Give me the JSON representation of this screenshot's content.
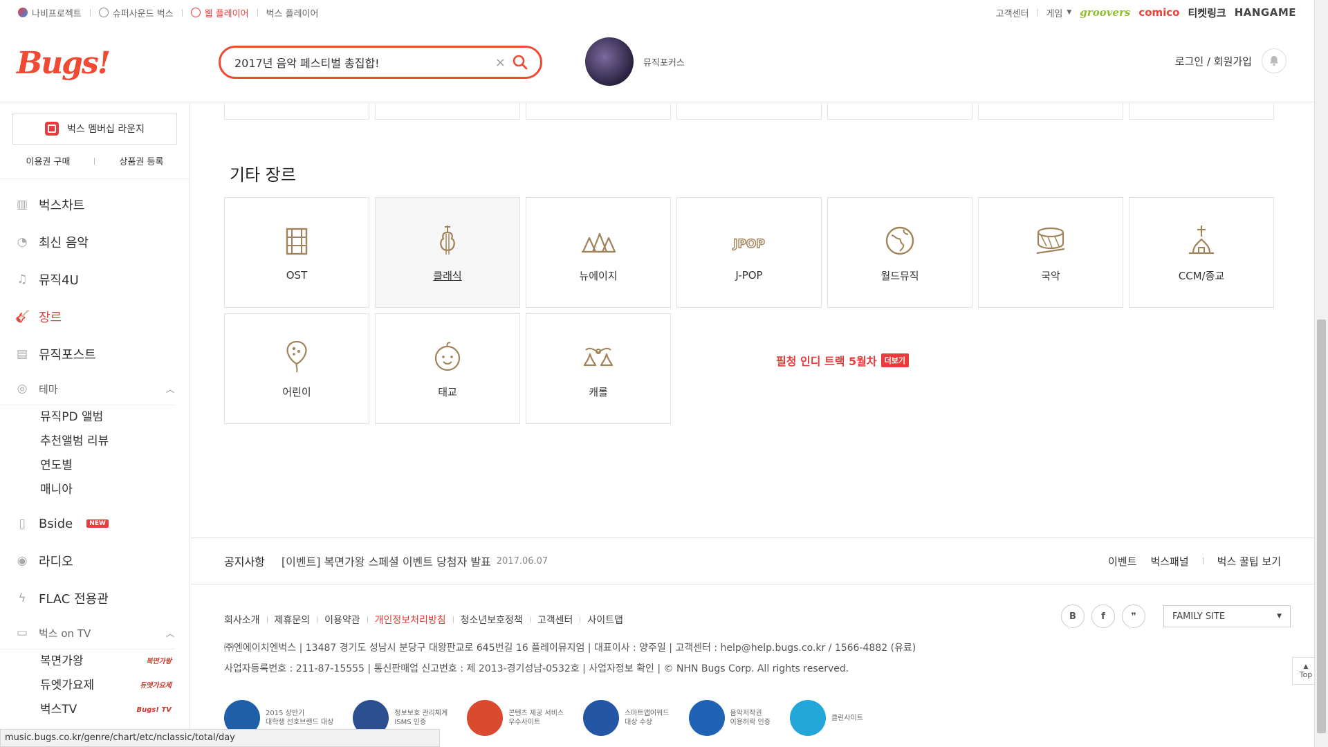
{
  "topbar": {
    "left_items": [
      {
        "label": "나비프로젝트",
        "active": false,
        "icon": "butterfly-icon"
      },
      {
        "label": "슈퍼사운드 벅스",
        "active": false,
        "icon": "bolt-icon"
      },
      {
        "label": "웹 플레이어",
        "active": true,
        "icon": "play-icon"
      },
      {
        "label": "벅스 플레이어",
        "active": false,
        "icon": ""
      }
    ],
    "right_links": [
      "고객센터",
      "게임"
    ],
    "brands": [
      "groovers",
      "comico",
      "티켓링크",
      "HANGAME"
    ]
  },
  "header": {
    "logo": "Bugs!",
    "search_value": "2017년 음악 페스티벌 총집합!",
    "promo_sub": "뮤직포커스",
    "promo_main": "필청 인디 트랙 5월차",
    "promo_more": "더보기",
    "login": "로그인 / 회원가입"
  },
  "sidebar": {
    "member_lounge": "벅스 멤버십 라운지",
    "buy": "이용권 구매",
    "coupon": "상품권 등록",
    "nav": [
      {
        "label": "벅스차트",
        "icon": "chart-icon",
        "active": false
      },
      {
        "label": "최신 음악",
        "icon": "new-music-icon",
        "active": false
      },
      {
        "label": "뮤직4U",
        "icon": "note-icon",
        "active": false
      },
      {
        "label": "장르",
        "icon": "guitar-icon",
        "active": true
      },
      {
        "label": "뮤직포스트",
        "icon": "post-icon",
        "active": false
      }
    ],
    "theme_label": "테마",
    "theme_items": [
      "뮤직PD 앨범",
      "추천앨범 리뷰",
      "연도별",
      "매니아"
    ],
    "nav2": [
      {
        "label": "Bside",
        "icon": "bside-icon",
        "new": "NEW"
      },
      {
        "label": "라디오",
        "icon": "radio-icon",
        "new": ""
      },
      {
        "label": "FLAC 전용관",
        "icon": "flac-icon",
        "new": ""
      }
    ],
    "tv_label": "벅스 on TV",
    "tv_items": [
      {
        "label": "복면가왕",
        "badge": "복면가왕"
      },
      {
        "label": "듀엣가요제",
        "badge": "듀엣가요제"
      },
      {
        "label": "벅스TV",
        "badge": "Bugs! TV"
      }
    ]
  },
  "main": {
    "section_title": "기타 장르",
    "genres": [
      {
        "label": "OST",
        "icon": "film-icon",
        "hover": false
      },
      {
        "label": "클래식",
        "icon": "violin-icon",
        "hover": true
      },
      {
        "label": "뉴에이지",
        "icon": "trees-icon",
        "hover": false
      },
      {
        "label": "J-POP",
        "icon": "jpop-icon",
        "hover": false
      },
      {
        "label": "월드뮤직",
        "icon": "globe-icon",
        "hover": false
      },
      {
        "label": "국악",
        "icon": "drum-icon",
        "hover": false
      },
      {
        "label": "CCM/종교",
        "icon": "church-icon",
        "hover": false
      },
      {
        "label": "어린이",
        "icon": "balloon-icon",
        "hover": false
      },
      {
        "label": "태교",
        "icon": "baby-icon",
        "hover": false
      },
      {
        "label": "캐롤",
        "icon": "bells-icon",
        "hover": false
      }
    ]
  },
  "notice": {
    "label": "공지사항",
    "text": "[이벤트] 복면가왕 스페셜 이벤트 당첨자 발표",
    "date": "2017.06.07",
    "links": [
      "이벤트",
      "벅스패널",
      "벅스 꿀팁 보기"
    ]
  },
  "footer": {
    "links": [
      {
        "label": "회사소개",
        "red": false
      },
      {
        "label": "제휴문의",
        "red": false
      },
      {
        "label": "이용약관",
        "red": false
      },
      {
        "label": "개인정보처리방침",
        "red": true
      },
      {
        "label": "청소년보호정책",
        "red": false
      },
      {
        "label": "고객센터",
        "red": false
      },
      {
        "label": "사이트맵",
        "red": false
      }
    ],
    "info1": "㈜엔에이치엔벅스 | 13487 경기도 성남시 분당구 대왕판교로 645번길 16 플레이뮤지엄 | 대표이사 : 양주일 | 고객센터 : help@help.bugs.co.kr / 1566-4882 (유료)",
    "info2": "사업자등록번호 : 211-87-15555 | 통신판매업 신고번호 : 제 2013-경기성남-0532호 | 사업자정보 확인 | © NHN Bugs Corp. All rights reserved.",
    "family_site": "FAMILY SITE",
    "sns": [
      "B",
      "f",
      "❞"
    ],
    "awards": [
      {
        "line1": "2015 상반기",
        "line2": "대학생 선호브랜드 대상",
        "color": "#1e5fa8"
      },
      {
        "line1": "정보보호 관리체계",
        "line2": "ISMS 인증",
        "color": "#2c4f8f"
      },
      {
        "line1": "콘텐츠 제공 서비스",
        "line2": "우수사이트",
        "color": "#d94a2e"
      },
      {
        "line1": "스마트앱어워드",
        "line2": "대상 수상",
        "color": "#2456a6"
      },
      {
        "line1": "음악저작권",
        "line2": "이용허락 인증",
        "color": "#1f63b4"
      },
      {
        "line1": "클린사이트",
        "line2": "",
        "color": "#22a7d8"
      }
    ],
    "top": "Top"
  },
  "status_url": "music.bugs.co.kr/genre/chart/etc/nclassic/total/day"
}
